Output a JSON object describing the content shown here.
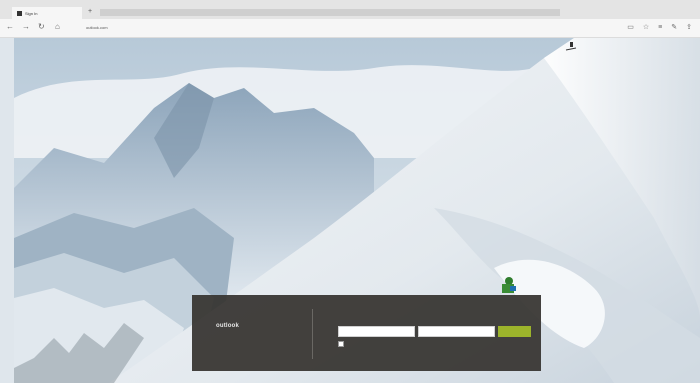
{
  "browser": {
    "tab_title": "Sign In",
    "new_tab_glyph": "+",
    "address": "outlook.com",
    "nav_icons": [
      "back-icon",
      "forward-icon",
      "refresh-icon",
      "home-icon"
    ],
    "toolbar_icons": [
      "reading-view-icon",
      "favorites-icon",
      "hub-icon",
      "note-icon",
      "share-icon"
    ]
  },
  "login": {
    "brand": "outlook",
    "brand_tagline": "",
    "username_label": "",
    "password_label": "",
    "username_value": "",
    "password_value": "",
    "remember_label": "",
    "links_text": "",
    "signin_label": "",
    "accent_color": "#9cb42b"
  }
}
